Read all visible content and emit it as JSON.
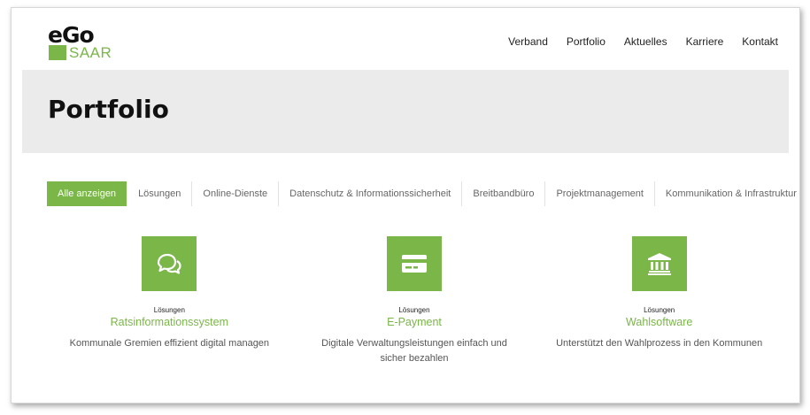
{
  "header": {
    "logo": {
      "top": "eGo",
      "bottom": "SAAR"
    },
    "nav": [
      "Verband",
      "Portfolio",
      "Aktuelles",
      "Karriere",
      "Kontakt"
    ]
  },
  "page_title": "Portfolio",
  "filters": [
    "Alle anzeigen",
    "Lösungen",
    "Online-Dienste",
    "Datenschutz & Informationssicherheit",
    "Breitbandbüro",
    "Projektmanagement",
    "Kommunikation & Infrastruktur"
  ],
  "active_filter": "Alle anzeigen",
  "cards": [
    {
      "icon": "chat-bubbles-icon",
      "category": "Lösungen",
      "title": "Ratsinformationssystem",
      "description": "Kommunale Gremien effizient digital managen"
    },
    {
      "icon": "credit-card-icon",
      "category": "Lösungen",
      "title": "E-Payment",
      "description": "Digitale Verwaltungsleistungen einfach und sicher bezahlen"
    },
    {
      "icon": "bank-building-icon",
      "category": "Lösungen",
      "title": "Wahlsoftware",
      "description": "Unterstützt den Wahlprozess in den Kommunen"
    }
  ],
  "colors": {
    "accent": "#7ab648",
    "title_band": "#ebebeb",
    "text": "#222222"
  }
}
